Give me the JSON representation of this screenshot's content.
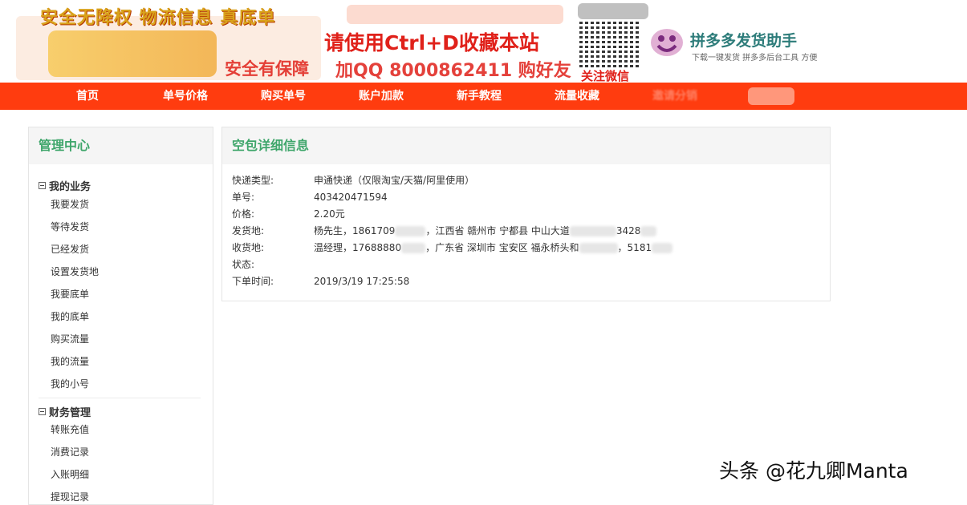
{
  "banner": {
    "title": "安全无降权 物流信息 真底单",
    "secure_text": "安全有保障",
    "slogan": "请使用Ctrl+D收藏本站",
    "qq_text": "加QQ 8000862411 购好友",
    "wechat": "关注微信",
    "helper_title": "拼多多发货助手",
    "helper_sub": "下载一键发货 拼多多后台工具 方便",
    "colors": {
      "slogan": "#e0211a",
      "title": "#d9a21b",
      "helper": "#2d7c7a"
    }
  },
  "nav": {
    "color": "#ff3c0f",
    "items": [
      "首页",
      "单号价格",
      "购买单号",
      "账户加款",
      "新手教程",
      "流量收藏",
      "邀请分销"
    ]
  },
  "sidebar": {
    "title": "管理中心",
    "groups": [
      {
        "title": "我的业务",
        "items": [
          "我要发货",
          "等待发货",
          "已经发货",
          "设置发货地",
          "我要底单",
          "我的底单",
          "购买流量",
          "我的流量",
          "我的小号"
        ]
      },
      {
        "title": "财务管理",
        "items": [
          "转账充值",
          "消费记录",
          "入账明细",
          "提现记录"
        ]
      }
    ]
  },
  "detail": {
    "title": "空包详细信息",
    "rows": [
      {
        "label": "快递类型:",
        "value": "申通快递（仅限淘宝/天猫/阿里使用）"
      },
      {
        "label": "单号:",
        "value": "403420471594"
      },
      {
        "label": "价格:",
        "value": "2.20元"
      },
      {
        "label": "发货地:",
        "value": "杨先生，1861709",
        "value2": "，江西省 赣州市 宁都县 中山大道",
        "value3": "3428"
      },
      {
        "label": "收货地:",
        "value": "温经理，17688880",
        "value2": "，广东省 深圳市 宝安区 福永桥头和",
        "value3": "，5181"
      },
      {
        "label": "状态:",
        "value": ""
      },
      {
        "label": "下单时间:",
        "value": "2019/3/19 17:25:58"
      }
    ]
  },
  "watermark": "头条 @花九卿Manta"
}
